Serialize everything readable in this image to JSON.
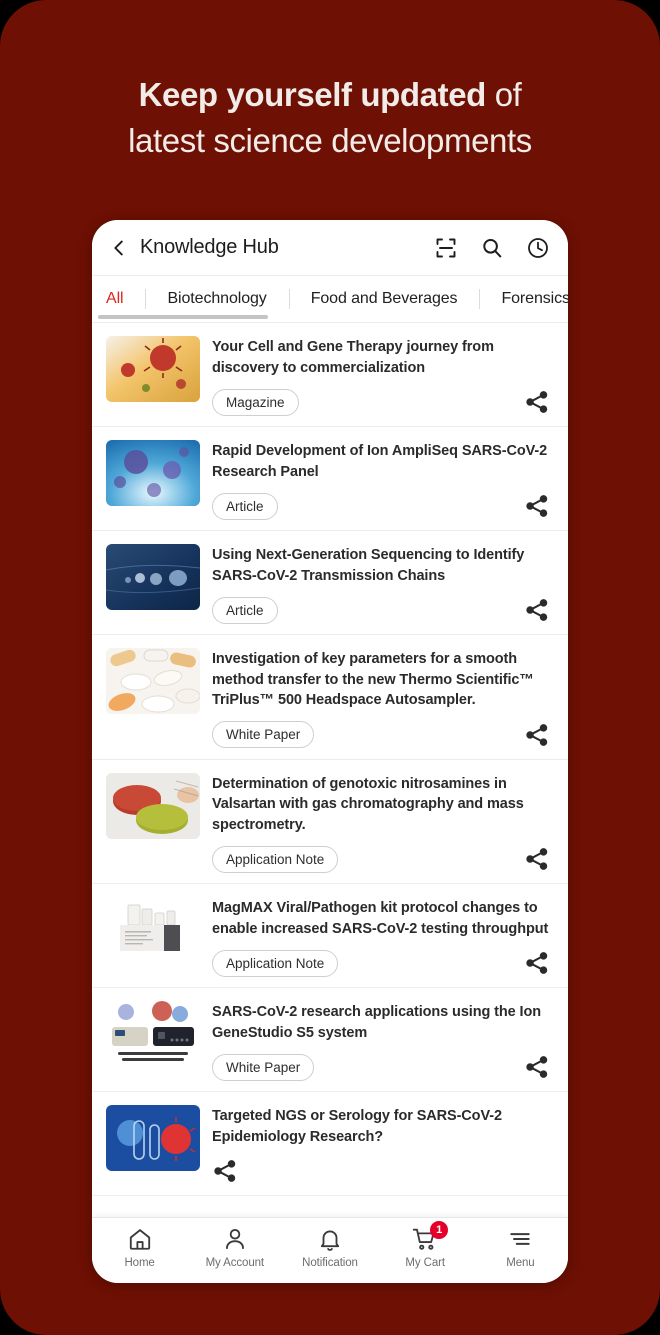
{
  "poster": {
    "background_color": "#6e1003",
    "headline_line1_bold": "Keep yourself updated",
    "headline_line1_rest": " of",
    "headline_line2": "latest science developments",
    "headline_color": "#f2ece9"
  },
  "app": {
    "header": {
      "back_icon": "chevron-left-icon",
      "title": "Knowledge Hub",
      "icons": [
        {
          "name": "scan-icon",
          "label": "Scan"
        },
        {
          "name": "search-icon",
          "label": "Search"
        },
        {
          "name": "history-clock-icon",
          "label": "History"
        }
      ]
    },
    "tabs": {
      "active_color": "#e0261b",
      "items": [
        {
          "label": "All",
          "active": true
        },
        {
          "label": "Biotechnology",
          "active": false
        },
        {
          "label": "Food and Beverages",
          "active": false
        },
        {
          "label": "Forensics",
          "active": false
        }
      ]
    },
    "list": [
      {
        "title": "Your Cell and Gene Therapy journey from discovery to commercialization",
        "tag": "Magazine",
        "thumb": "virus-orange",
        "share_icon": "share-icon"
      },
      {
        "title": "Rapid Development of Ion AmpliSeq SARS-CoV-2 Research Panel",
        "tag": "Article",
        "thumb": "virus-blue",
        "share_icon": "share-icon"
      },
      {
        "title": "Using Next-Generation Sequencing to Identify SARS-CoV-2 Transmission Chains",
        "tag": "Article",
        "thumb": "navy-cells",
        "share_icon": "share-icon"
      },
      {
        "title": "Investigation of key parameters for a smooth method transfer to the new Thermo Scientific™ TriPlus™ 500 Headspace Autosampler.",
        "tag": "White Paper",
        "thumb": "pills-white",
        "share_icon": "share-icon"
      },
      {
        "title": "Determination of genotoxic nitrosamines in Valsartan with gas chromatography and mass spectrometry.",
        "tag": "Application Note",
        "thumb": "tablets-red-green",
        "share_icon": "share-icon"
      },
      {
        "title": "MagMAX Viral/Pathogen kit protocol changes to enable increased SARS-CoV-2 testing throughput",
        "tag": "Application Note",
        "thumb": "lab-kit-box",
        "share_icon": "share-icon"
      },
      {
        "title": "SARS-CoV-2 research applications using the Ion GeneStudio S5 system",
        "tag": "White Paper",
        "thumb": "instruments",
        "thumb_caption": "Powerful, user-friendly analysis of SARS-CoV-2",
        "share_icon": "share-icon"
      },
      {
        "title": "Targeted NGS or Serology for SARS-CoV-2 Epidemiology Research?",
        "tag": "",
        "thumb": "tubes-virus-blue",
        "share_icon": "share-icon"
      }
    ],
    "bottom_nav": [
      {
        "label": "Home",
        "icon": "home-icon",
        "badge": ""
      },
      {
        "label": "My Account",
        "icon": "person-icon",
        "badge": ""
      },
      {
        "label": "Notification",
        "icon": "bell-icon",
        "badge": ""
      },
      {
        "label": "My Cart",
        "icon": "cart-icon",
        "badge": "1"
      },
      {
        "label": "Menu",
        "icon": "hamburger-menu-icon",
        "badge": ""
      }
    ]
  }
}
